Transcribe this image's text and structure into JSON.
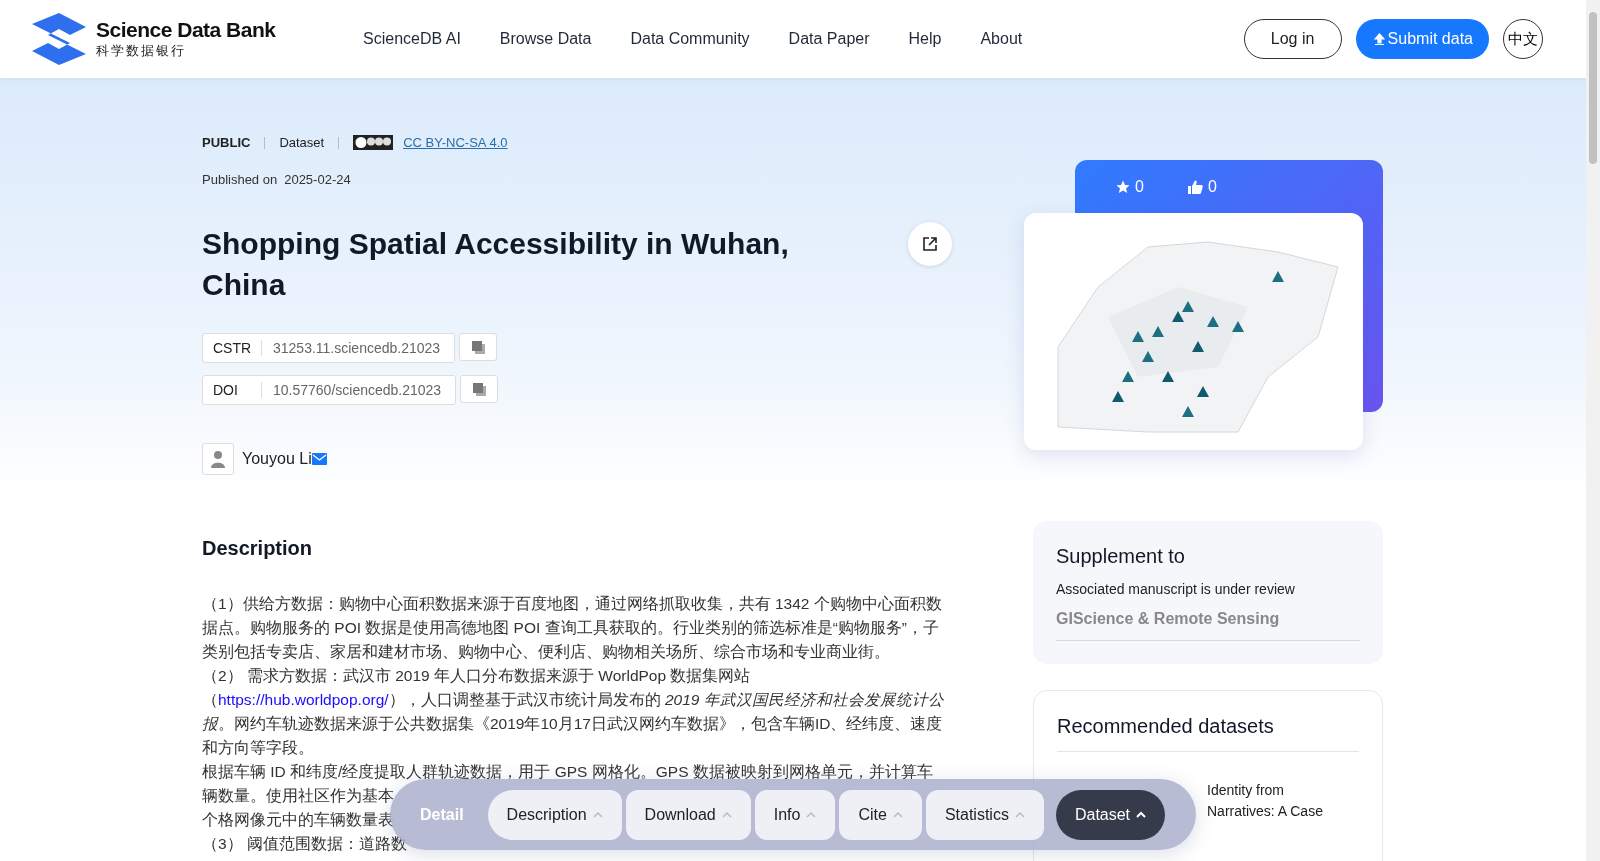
{
  "header": {
    "logo": {
      "title": "Science Data Bank",
      "subtitle": "科学数据银行"
    },
    "nav": [
      "ScienceDB AI",
      "Browse Data",
      "Data Community",
      "Data Paper",
      "Help",
      "About"
    ],
    "login": "Log in",
    "submit": "Submit data",
    "language": "中文"
  },
  "dataset": {
    "access": "PUBLIC",
    "type": "Dataset",
    "license": "CC BY-NC-SA 4.0",
    "published_label": "Published on",
    "published_date": "2025-02-24",
    "title": "Shopping Spatial Accessibility in Wuhan, China",
    "identifiers": [
      {
        "label": "CSTR",
        "value": "31253.11.sciencedb.21023"
      },
      {
        "label": "DOI",
        "value": "10.57760/sciencedb.21023"
      }
    ],
    "author": "Youyou Li"
  },
  "stats": {
    "favorites": "0",
    "likes": "0"
  },
  "description": {
    "heading": "Description",
    "paragraph_1": "（1）供给方数据：购物中心面积数据来源于百度地图，通过网络抓取收集，共有 1342 个购物中心面积数据点。购物服务的 POI 数据是使用高德地图 POI 查询工具获取的。行业类别的筛选标准是“购物服务”，子类别包括专卖店、家居和建材市场、购物中心、便利店、购物相关场所、综合市场和专业商业街。",
    "paragraph_2": {
      "before": "（2） 需求方数据：武汉市 2019 年人口分布数据来源于 WorldPop 数据集网站（",
      "link": "https://hub.worldpop.org/",
      "after": "），人口调整基于武汉市统计局发布的 *2019 年武汉国民经济和社会发展统计公报*。网约车轨迹数据来源于公共数据集《2019年10月17日武汉网约车数据》，包含车辆ID、经纬度、速度和方向等字段。"
    },
    "lines": [
      "根据车辆 ID 和纬度/经度提取人群轨迹数据，用于 GPS 网格化。GPS 数据被映射到网格单元，并计算车",
      "辆数量。使用社区作为基本",
      "个格网像元中的车辆数量表",
      "（3） 阈值范围数据：道路数"
    ]
  },
  "supplement": {
    "heading": "Supplement to",
    "note": "Associated manuscript is under review",
    "journal": "GIScience & Remote Sensing"
  },
  "recommended": {
    "heading": "Recommended datasets",
    "item_lines": [
      "Identity from",
      "Narratives: A Case"
    ]
  },
  "section_bar": {
    "label": "Detail",
    "tabs": [
      {
        "label": "Description",
        "selected": false
      },
      {
        "label": "Download",
        "selected": false
      },
      {
        "label": "Info",
        "selected": false
      },
      {
        "label": "Cite",
        "selected": false
      },
      {
        "label": "Statistics",
        "selected": false
      },
      {
        "label": "Dataset",
        "selected": true
      }
    ]
  }
}
